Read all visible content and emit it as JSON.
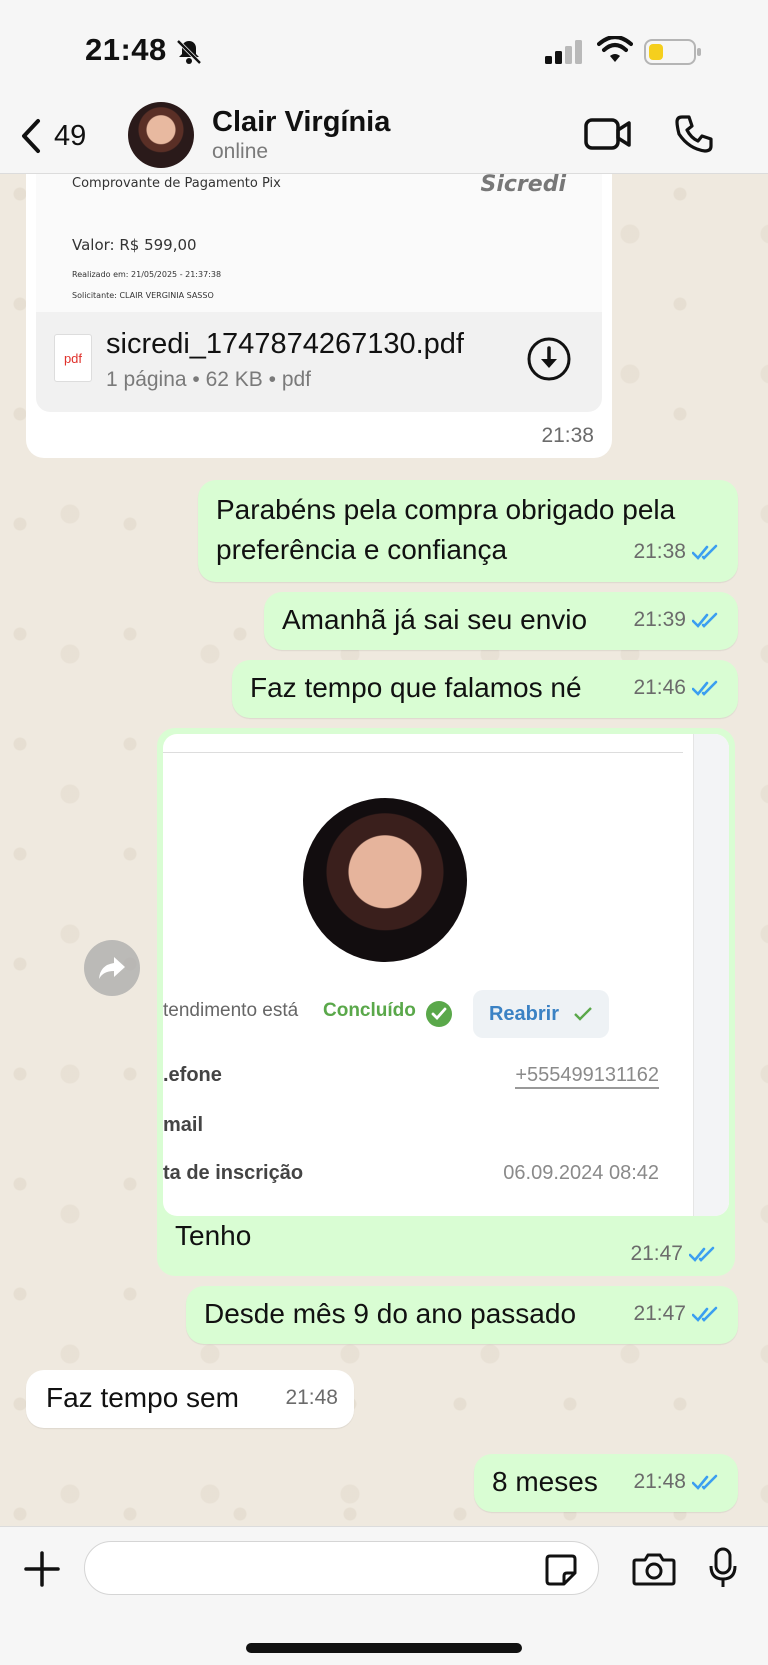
{
  "status_bar": {
    "time": "21:48"
  },
  "header": {
    "back_count": "49",
    "contact_name": "Clair Virgínia",
    "contact_status": "online"
  },
  "document": {
    "preview": {
      "title": "Comprovante de Pagamento Pix",
      "brand": "Sicredi",
      "value_line": "Valor: R$ 599,00",
      "realizado_line": "Realizado em: 21/05/2025 - 21:37:38",
      "solicitante_line": "Solicitante: CLAIR VERGINIA SASSO"
    },
    "icon_label": "pdf",
    "file_name": "sicredi_1747874267130.pdf",
    "file_info": "1 página • 62 KB • pdf",
    "time": "21:38"
  },
  "messages": [
    {
      "text": "Parabéns pela compra obrigado pela preferência e confiança",
      "time": "21:38"
    },
    {
      "text": "Amanhã já sai seu envio",
      "time": "21:39"
    },
    {
      "text": "Faz tempo que falamos né",
      "time": "21:46"
    }
  ],
  "image_message": {
    "status_label": "tendimento está",
    "status_value": "Concluído",
    "reopen_label": "Reabrir",
    "fields": [
      {
        "key": ".efone",
        "value": "+555499131162"
      },
      {
        "key": "mail",
        "value": ""
      },
      {
        "key": "ta de inscrição",
        "value": "06.09.2024 08:42"
      }
    ],
    "caption": "Tenho",
    "time": "21:47"
  },
  "messages_after": [
    {
      "text": "Desde mês 9 do ano passado",
      "time": "21:47",
      "direction": "out"
    },
    {
      "text": "Faz tempo sem",
      "time": "21:48",
      "direction": "in"
    },
    {
      "text": "8 meses",
      "time": "21:48",
      "direction": "out"
    }
  ],
  "composer": {
    "placeholder": ""
  },
  "colors": {
    "outgoing_bubble": "#d9fdd3",
    "incoming_bubble": "#ffffff",
    "read_ticks": "#3b9ef0",
    "status_concluded": "#5aa84a"
  }
}
